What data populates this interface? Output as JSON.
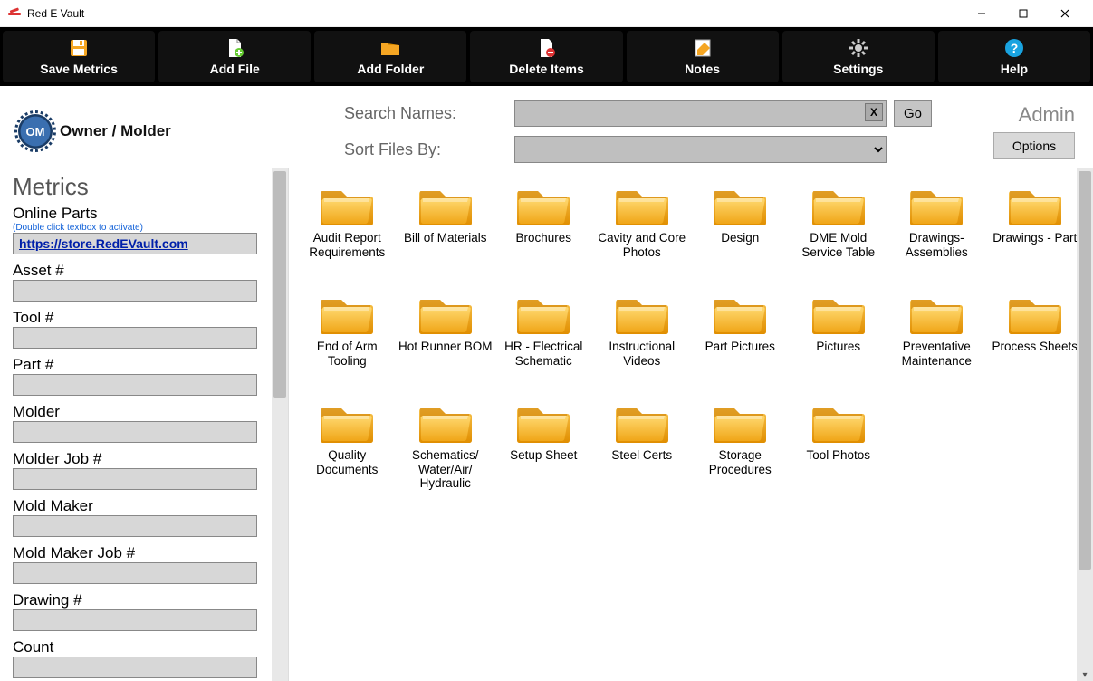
{
  "window": {
    "title": "Red E Vault"
  },
  "toolbar": {
    "save_metrics": "Save Metrics",
    "add_file": "Add File",
    "add_folder": "Add Folder",
    "delete_items": "Delete Items",
    "notes": "Notes",
    "settings": "Settings",
    "help": "Help"
  },
  "header": {
    "logo_initials": "OM",
    "logo_text": "Owner / Molder",
    "search_label": "Search Names:",
    "sort_label": "Sort Files By:",
    "go_label": "Go",
    "search_value": "",
    "sort_value": "",
    "clear_label": "X",
    "admin_label": "Admin",
    "options_label": "Options"
  },
  "metrics": {
    "heading": "Metrics",
    "online_parts": {
      "label": "Online Parts",
      "hint": "(Double click textbox to activate)",
      "value": "https://store.RedEVault.com"
    },
    "fields": [
      {
        "label": "Asset #",
        "value": ""
      },
      {
        "label": "Tool #",
        "value": ""
      },
      {
        "label": "Part #",
        "value": ""
      },
      {
        "label": "Molder",
        "value": ""
      },
      {
        "label": "Molder Job #",
        "value": ""
      },
      {
        "label": "Mold Maker",
        "value": ""
      },
      {
        "label": "Mold Maker Job #",
        "value": ""
      },
      {
        "label": "Drawing #",
        "value": ""
      },
      {
        "label": "Count",
        "value": ""
      }
    ]
  },
  "folders": [
    "Audit Report Requirements",
    "Bill of Materials",
    "Brochures",
    "Cavity and Core Photos",
    "Design",
    "DME Mold Service Table",
    "Drawings-Assemblies",
    "Drawings - Part",
    "End of Arm Tooling",
    "Hot Runner BOM",
    "HR - Electrical Schematic",
    "Instructional Videos",
    "Part Pictures",
    "Pictures",
    "Preventative Maintenance",
    "Process Sheets",
    "Quality Documents",
    "Schematics/ Water/Air/ Hydraulic",
    "Setup Sheet",
    "Steel Certs",
    "Storage Procedures",
    "Tool Photos"
  ]
}
